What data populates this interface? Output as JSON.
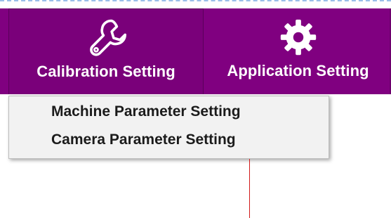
{
  "ribbon": {
    "tabs": [
      {
        "label": "Calibration Setting",
        "icon": "wrench-icon"
      },
      {
        "label": "Application Setting",
        "icon": "gear-icon"
      }
    ]
  },
  "dropdown": {
    "items": [
      {
        "label": "Machine Parameter Setting"
      },
      {
        "label": "Camera Parameter Setting"
      }
    ]
  },
  "colors": {
    "ribbon": "#800080",
    "dropdown_bg": "#f2f2f2",
    "text_dark": "#1b1b1b",
    "accent_line": "#d11a1a"
  }
}
